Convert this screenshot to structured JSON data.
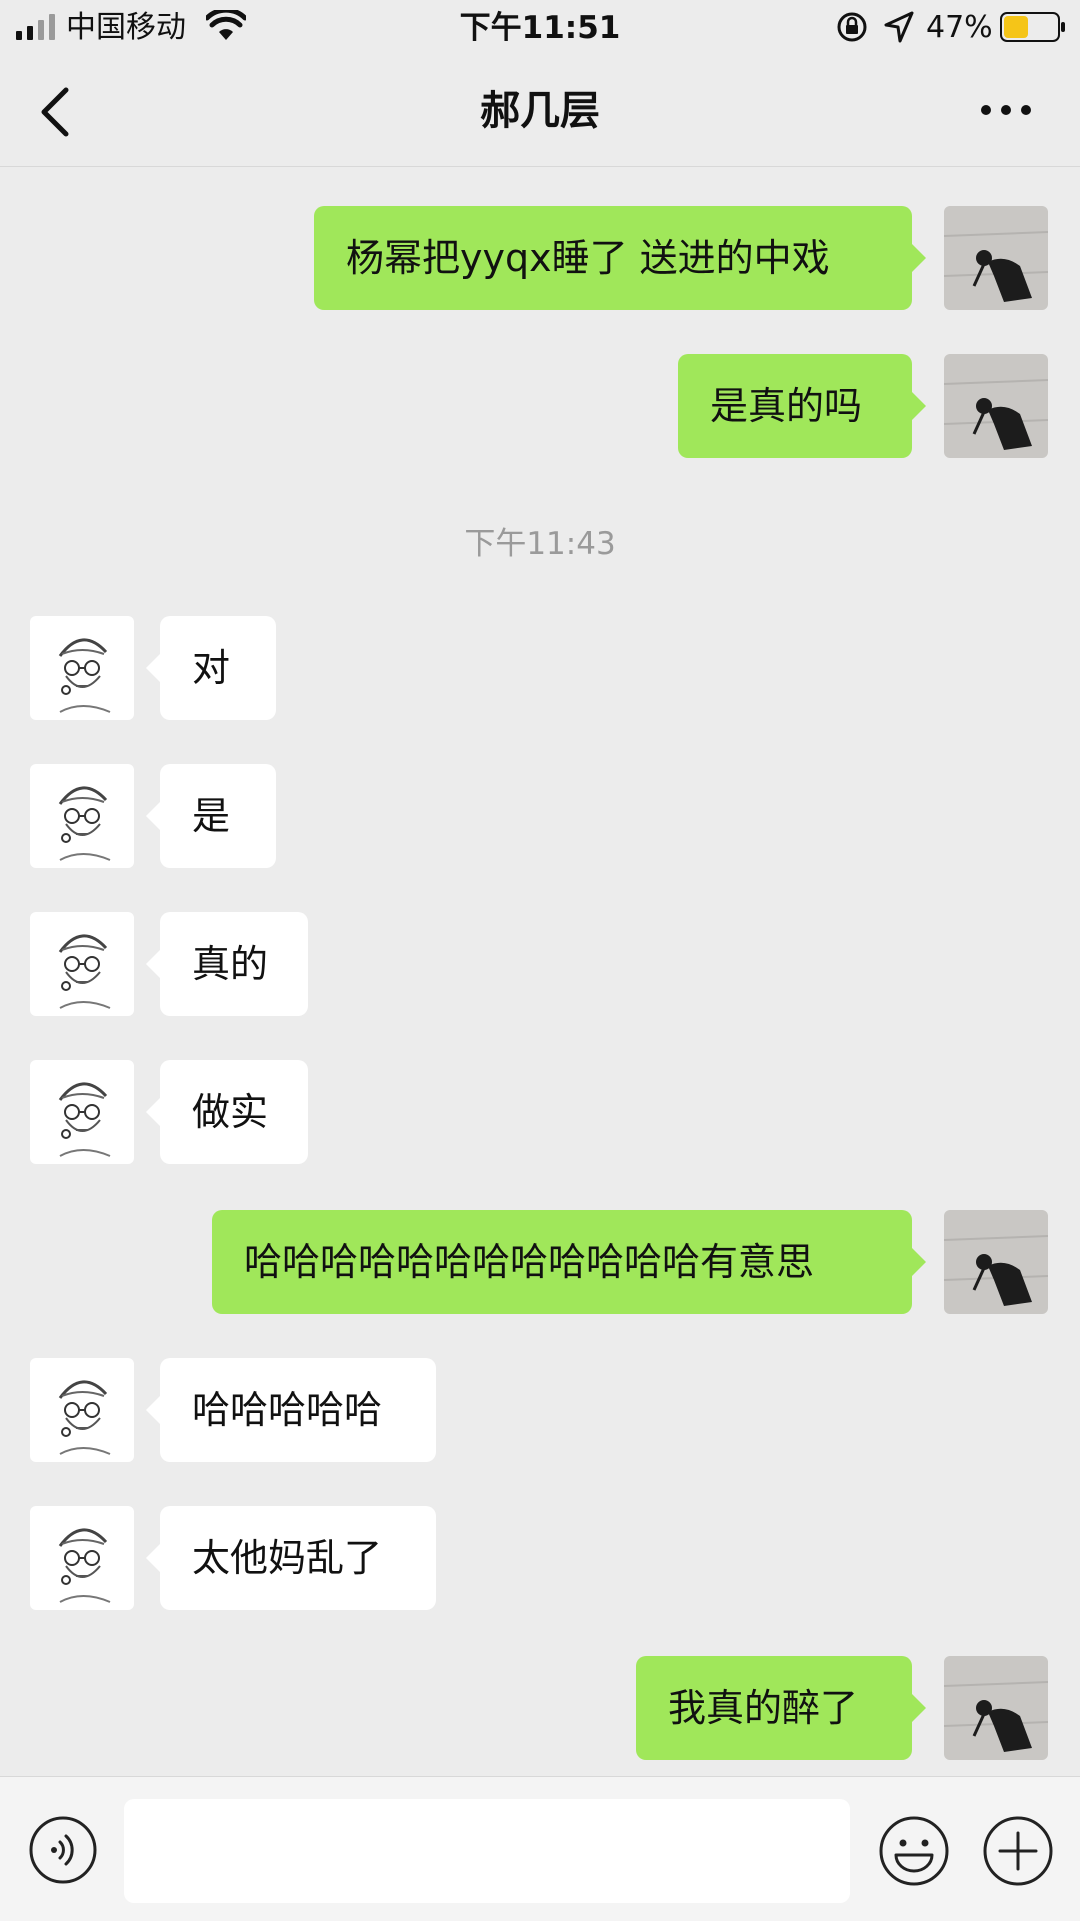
{
  "status_bar": {
    "carrier": "中国移动",
    "time": "下午11:51",
    "battery_percent": "47%",
    "battery_level": 0.47,
    "battery_color": "#f5c518"
  },
  "nav": {
    "title": "郝几层",
    "back_icon": "chevron-left-icon",
    "more_icon": "more-dots-icon"
  },
  "timestamp": "下午11:43",
  "messages": [
    {
      "sender": "me",
      "text": "杨幂把yyqx睡了 送进的中戏"
    },
    {
      "sender": "me",
      "text": "是真的吗"
    },
    {
      "sender": "them",
      "text": "对"
    },
    {
      "sender": "them",
      "text": "是"
    },
    {
      "sender": "them",
      "text": "真的"
    },
    {
      "sender": "them",
      "text": "做实"
    },
    {
      "sender": "me",
      "text": "哈哈哈哈哈哈哈哈哈哈哈哈有意思"
    },
    {
      "sender": "them",
      "text": "哈哈哈哈哈"
    },
    {
      "sender": "them",
      "text": "太他妈乱了"
    },
    {
      "sender": "me",
      "text": "我真的醉了"
    }
  ],
  "input_bar": {
    "voice_icon": "voice-icon",
    "text_value": "",
    "emoji_icon": "emoji-icon",
    "plus_icon": "plus-icon"
  },
  "colors": {
    "my_bubble": "#a0e75a",
    "their_bubble": "#ffffff",
    "background": "#ececec"
  }
}
